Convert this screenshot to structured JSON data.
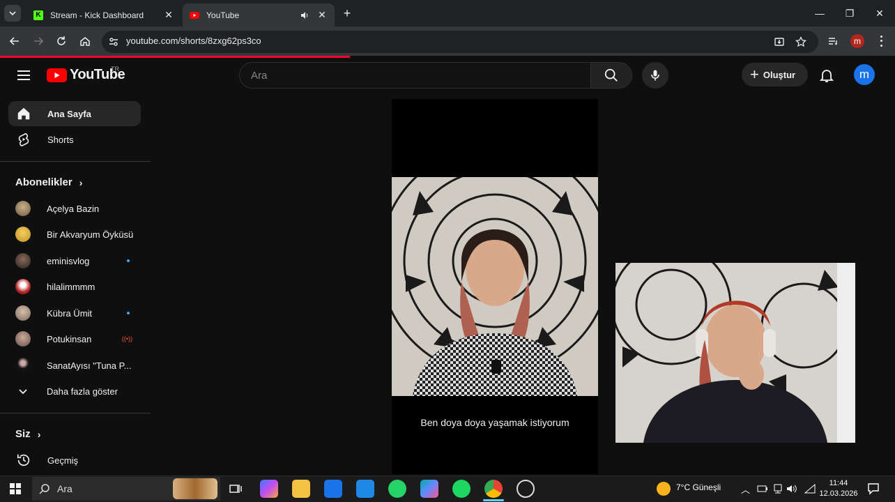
{
  "browser": {
    "tabs": [
      {
        "title": "Stream - Kick Dashboard",
        "active": false
      },
      {
        "title": "YouTube",
        "active": true
      }
    ],
    "url": "youtube.com/shorts/8zxg62ps3co",
    "profile_initial": "m"
  },
  "youtube": {
    "logo_text": "YouTube",
    "country_code": "TR",
    "search_placeholder": "Ara",
    "create_label": "Oluştur",
    "avatar_initial": "m"
  },
  "sidebar": {
    "main": [
      {
        "label": "Ana Sayfa",
        "icon": "home-icon"
      },
      {
        "label": "Shorts",
        "icon": "shorts-icon"
      }
    ],
    "subscriptions_heading": "Abonelikler",
    "subscriptions": [
      {
        "name": "Açelya Bazin",
        "indicator": "",
        "color": "#8a7a60"
      },
      {
        "name": "Bir Akvaryum Öyküsü",
        "indicator": "",
        "color": "#d4b64a"
      },
      {
        "name": "eminisvlog",
        "indicator": "dot",
        "color": "#5a4a40"
      },
      {
        "name": "hilalimmmm",
        "indicator": "",
        "color": "#b33"
      },
      {
        "name": "Kübra Ümit",
        "indicator": "dot",
        "color": "#9a8878"
      },
      {
        "name": "Potukinsan",
        "indicator": "live",
        "color": "#a08a80"
      },
      {
        "name": "SanatAyısı \"Tuna P...",
        "indicator": "",
        "color": "#222"
      }
    ],
    "show_more": "Daha fazla göster",
    "you_heading": "Siz",
    "history_label": "Geçmiş"
  },
  "video": {
    "caption": "Ben doya doya yaşamak istiyorum"
  },
  "taskbar": {
    "search_label": "Ara",
    "weather": "7°C  Güneşli",
    "time": "11:44",
    "date": "12.03.2026"
  }
}
